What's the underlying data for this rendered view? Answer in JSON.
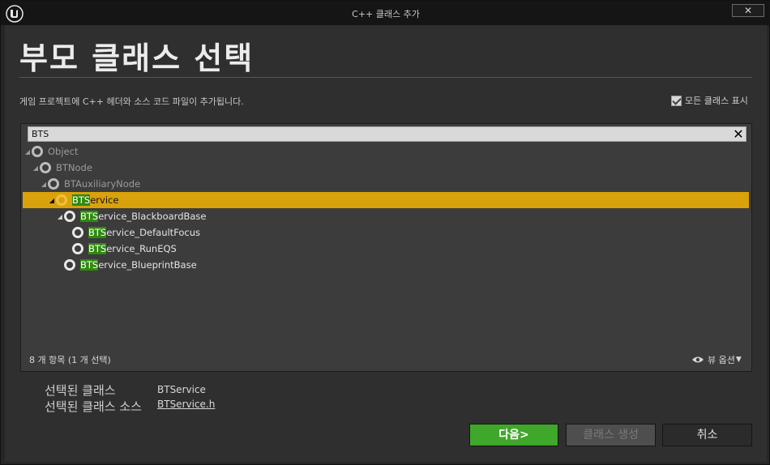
{
  "window": {
    "title": "C++ 클래스 추가",
    "close_glyph": "✕"
  },
  "header": {
    "heading": "부모 클래스 선택",
    "subtext": "게임 프로젝트에 C++ 헤더와 소스 코드 파일이 추가됩니다.",
    "show_all_label": "모든 클래스 표시",
    "show_all_checked": true
  },
  "search": {
    "value": "BTS",
    "clear_glyph": "✕"
  },
  "tree": {
    "items": [
      {
        "match": "",
        "rest": "Object",
        "expanded": true,
        "state": "dim"
      },
      {
        "match": "",
        "rest": "BTNode",
        "expanded": true,
        "state": "dim"
      },
      {
        "match": "",
        "rest": "BTAuxiliaryNode",
        "expanded": true,
        "state": "dim"
      },
      {
        "match": "BTS",
        "rest": "ervice",
        "expanded": true,
        "state": "selected"
      },
      {
        "match": "BTS",
        "rest": "ervice_BlackboardBase",
        "expanded": true,
        "state": "normal"
      },
      {
        "match": "BTS",
        "rest": "ervice_DefaultFocus",
        "expanded": false,
        "state": "normal"
      },
      {
        "match": "BTS",
        "rest": "ervice_RunEQS",
        "expanded": false,
        "state": "normal"
      },
      {
        "match": "BTS",
        "rest": "ervice_BlueprintBase",
        "expanded": false,
        "state": "normal"
      }
    ]
  },
  "footer": {
    "count": "8 개 항목 (1 개 선택)",
    "view_options": "뷰 옵션"
  },
  "selection": {
    "class_label": "선택된 클래스",
    "class_value": "BTService",
    "source_label": "선택된 클래스 소스",
    "source_value": "BTService.h"
  },
  "buttons": {
    "next": "다음",
    "next_glyph": ">",
    "create": "클래스 생성",
    "cancel": "취소"
  },
  "colors": {
    "selected_row": "#d9a10a",
    "match_highlight": "#2f8a0e",
    "next_button": "#3fa72a"
  }
}
